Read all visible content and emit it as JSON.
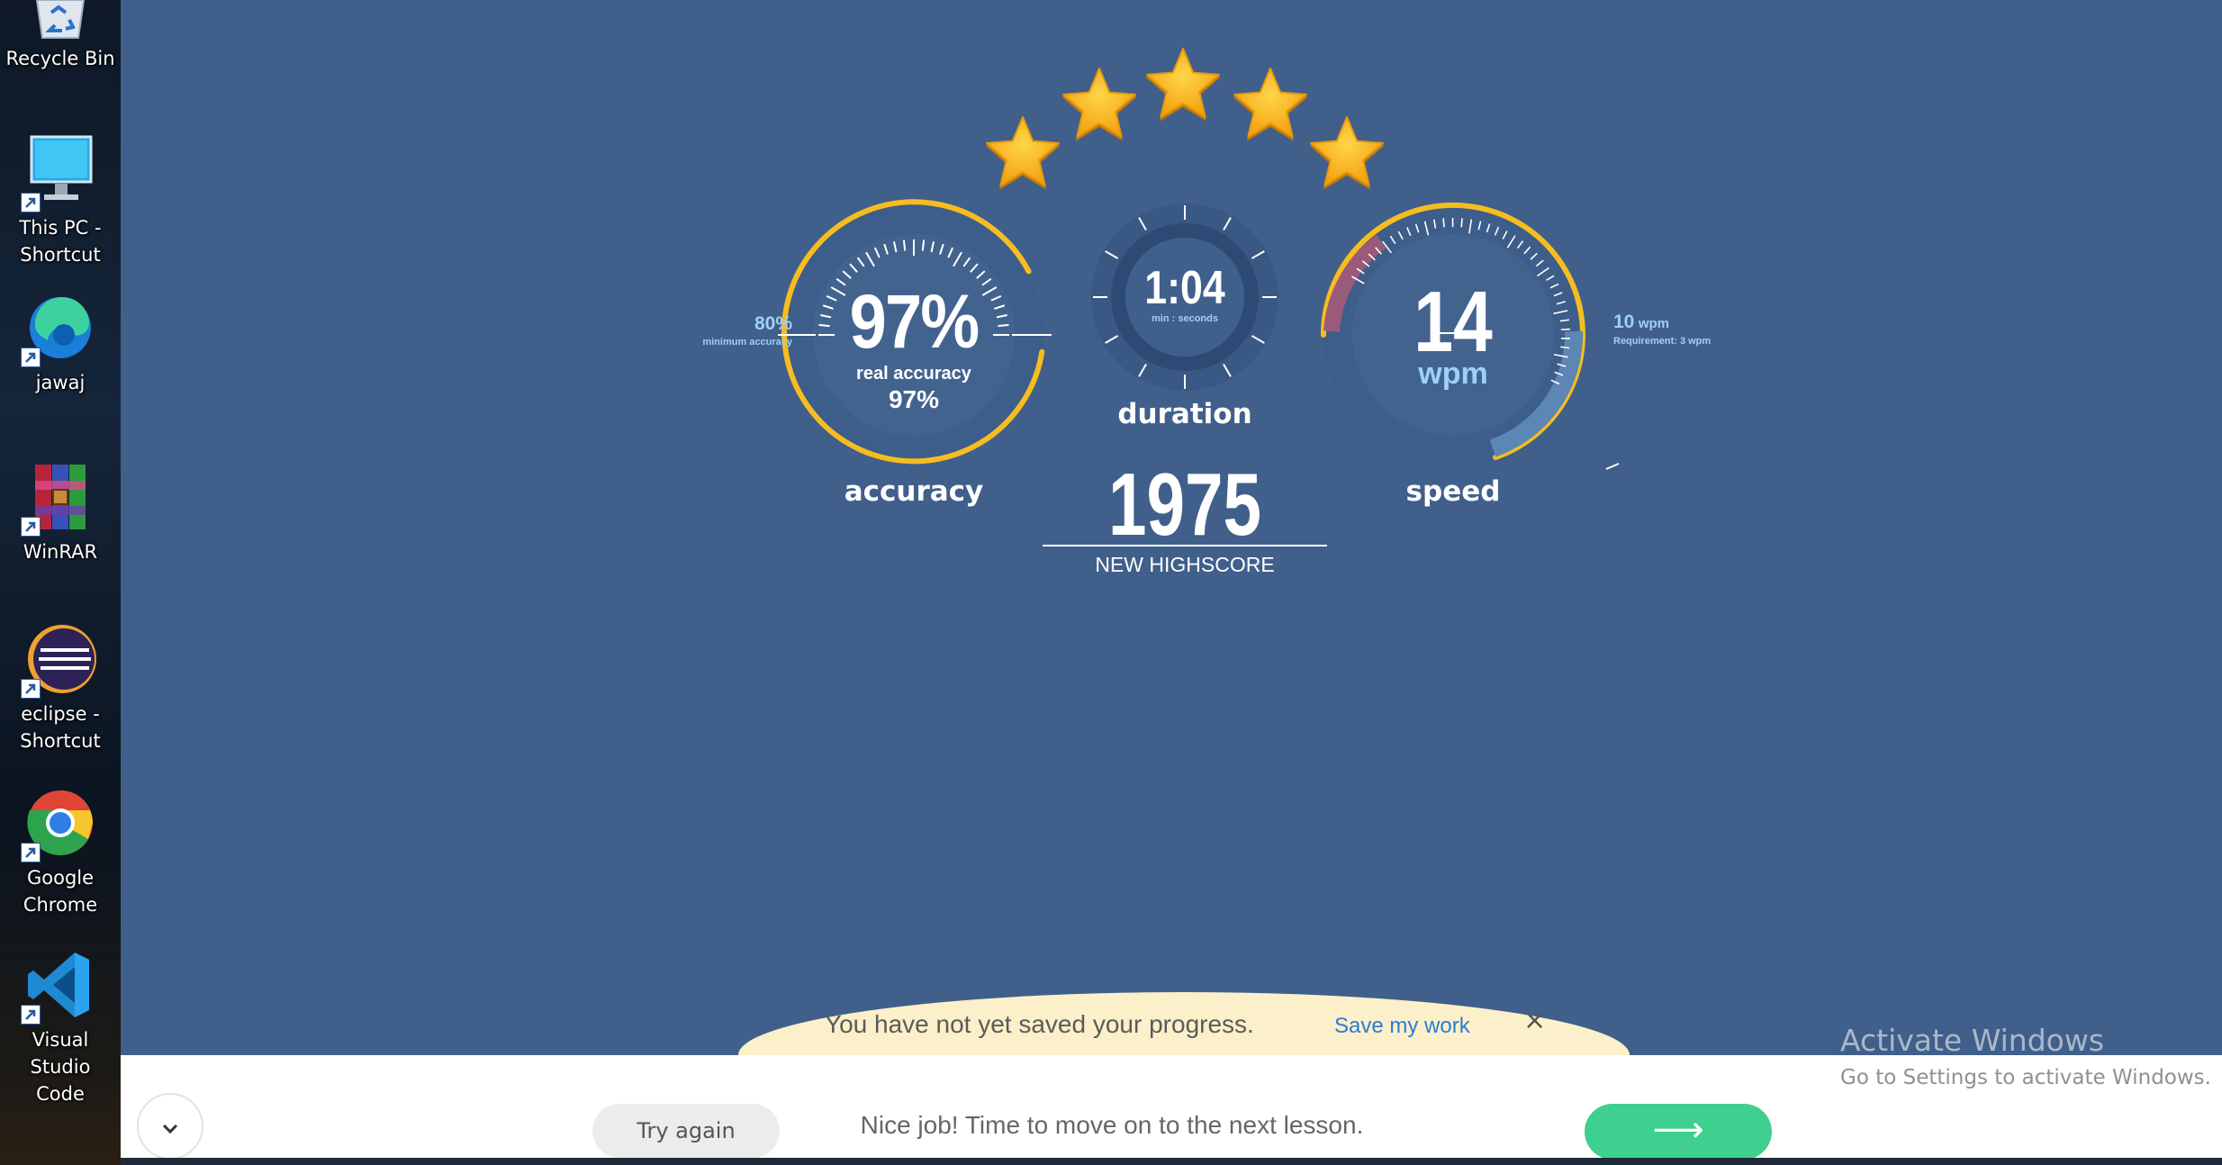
{
  "desktop": {
    "icons": [
      {
        "label": "Recycle Bin",
        "icon": "recycle-bin-icon"
      },
      {
        "label": "This PC - Shortcut",
        "label_l1": "This PC -",
        "label_l2": "Shortcut",
        "icon": "monitor-icon"
      },
      {
        "label": "jawaj",
        "icon": "edge-icon"
      },
      {
        "label": "WinRAR",
        "icon": "winrar-icon"
      },
      {
        "label": "eclipse - Shortcut",
        "label_l1": "eclipse -",
        "label_l2": "Shortcut",
        "icon": "eclipse-icon"
      },
      {
        "label": "Google Chrome",
        "label_l1": "Google",
        "label_l2": "Chrome",
        "icon": "chrome-icon"
      },
      {
        "label": "Visual Studio Code",
        "label_l1": "Visual Studio",
        "label_l2": "Code",
        "icon": "vscode-icon"
      }
    ]
  },
  "results": {
    "stars": 5,
    "stars_max": 5,
    "accuracy": {
      "value": "97%",
      "sub_label": "real accuracy",
      "sub_value": "97%",
      "label": "accuracy",
      "min_value": "80%",
      "min_label": "minimum accuracy"
    },
    "duration": {
      "value": "1:04",
      "unit": "min : seconds",
      "label": "duration"
    },
    "speed": {
      "value": "14",
      "unit": "wpm",
      "label": "speed",
      "target_value": "10",
      "target_unit": "wpm",
      "requirement": "Requirement: 3 wpm"
    },
    "score": {
      "value": "1975",
      "label": "NEW HIGHSCORE"
    }
  },
  "save_banner": {
    "message": "You have not yet saved your progress.",
    "link": "Save my work",
    "close": "×"
  },
  "footer": {
    "try_again": "Try again",
    "message": "Nice job! Time to move on to the next lesson.",
    "next_arrow": "⟶"
  },
  "watermark": {
    "title": "Activate Windows",
    "subtitle": "Go to Settings to activate Windows."
  },
  "colors": {
    "background": "#405f8b",
    "gauge_ring": "#f5bd1f",
    "gauge_face": "#3d5d8a",
    "speed_fill": "#5c86b3",
    "speed_low": "#9a5a7a",
    "next_button": "#3fcf8e",
    "save_link": "#2b7bd8"
  }
}
